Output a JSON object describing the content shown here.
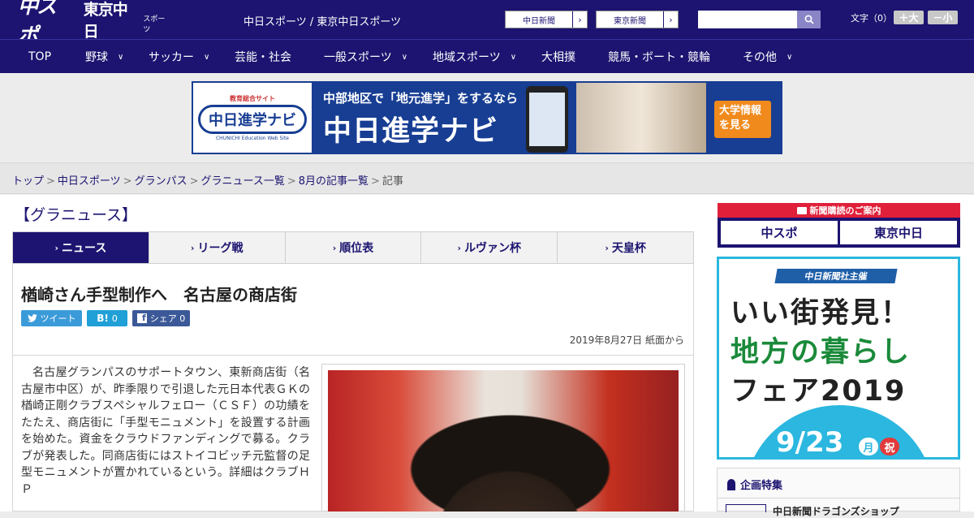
{
  "header": {
    "logo_main": "中スポ",
    "logo_sub": "東京中日",
    "logo_sub_small": "スポーツ",
    "site_names": "中日スポーツ / 東京中日スポーツ",
    "paper_links": [
      "中日新聞",
      "東京新聞"
    ],
    "search_placeholder": "",
    "font_size_label": "文字（0）",
    "font_bigger": "＋大",
    "font_smaller": "－小"
  },
  "nav": {
    "items": [
      {
        "label": "TOP",
        "has_menu": false
      },
      {
        "label": "野球",
        "has_menu": true
      },
      {
        "label": "サッカー",
        "has_menu": true
      },
      {
        "label": "芸能・社会",
        "has_menu": false
      },
      {
        "label": "一般スポーツ",
        "has_menu": true
      },
      {
        "label": "地域スポーツ",
        "has_menu": true
      },
      {
        "label": "大相撲",
        "has_menu": false
      },
      {
        "label": "競馬・ボート・競輪",
        "has_menu": false
      },
      {
        "label": "その他",
        "has_menu": true
      }
    ]
  },
  "banner": {
    "badge_small": "教育総合サイト",
    "badge_main": "中日進学ナビ",
    "badge_en": "CHUNICHI Education Web Site",
    "line1": "中部地区で「地元進学」をするなら",
    "line2": "中日進学ナビ",
    "cta": "大学情報を見る"
  },
  "breadcrumb": {
    "links": [
      "トップ",
      "中日スポーツ",
      "グランパス",
      "グラニュース一覧",
      "8月の記事一覧"
    ],
    "current": "記事"
  },
  "section": {
    "title": "【グラニュース】"
  },
  "tabs": [
    {
      "label": "ニュース",
      "active": true
    },
    {
      "label": "リーグ戦",
      "active": false
    },
    {
      "label": "順位表",
      "active": false
    },
    {
      "label": "ルヴァン杯",
      "active": false
    },
    {
      "label": "天皇杯",
      "active": false
    }
  ],
  "article": {
    "headline": "楢崎さん手型制作へ　名古屋の商店街",
    "share": {
      "tweet": "ツイート",
      "hatena_count": "0",
      "facebook": "シェア 0"
    },
    "date": "2019年8月27日 紙面から",
    "body": "名古屋グランパスのサポートタウン、東新商店街（名古屋市中区）が、昨季限りで引退した元日本代表ＧＫの楢崎正剛クラブスペシャルフェロー（ＣＳＦ）の功績をたたえ、商店街に「手型モニュメント」を設置する計画を始めた。資金をクラウドファンディングで募る。クラブが発表した。同商店街にはストイコビッチ元監督の足型モニュメントが置かれているという。詳細はクラブＨＰ"
  },
  "sidebar": {
    "subscribe_header": "新聞購読のご案内",
    "subscribe_left": "中スポ",
    "subscribe_right": "東京中日",
    "ad_tag": "中日新聞社主催",
    "ad_line1": "いい街発見！",
    "ad_line2": "地方の暮らし",
    "ad_line3": "フェア2019",
    "ad_date": "9/23",
    "ad_dow": "月",
    "ad_holiday": "祝",
    "feature_title": "企画特集",
    "feature_item": "中日新聞ドラゴンズショップ"
  },
  "colors": {
    "brand_navy": "#1c1470",
    "accent_red": "#e0203a",
    "twitter": "#3b9bd9",
    "hatena": "#20a0d6",
    "facebook": "#3b5998"
  }
}
